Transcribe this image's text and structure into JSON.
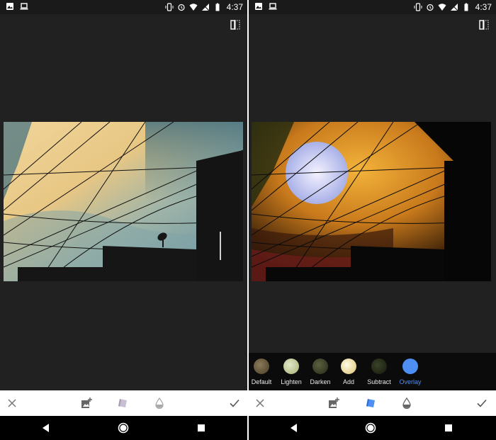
{
  "status": {
    "time": "4:37"
  },
  "blend_modes": [
    {
      "label": "Default",
      "color": "#6b5a3a",
      "active": false
    },
    {
      "label": "Lighten",
      "color": "#b9c29a",
      "active": false
    },
    {
      "label": "Darken",
      "color": "#38402c",
      "active": false
    },
    {
      "label": "Add",
      "color": "#f2eccc",
      "active": false
    },
    {
      "label": "Subtract",
      "color": "#232a18",
      "active": false
    },
    {
      "label": "Overlay",
      "color": "#4e8ff4",
      "active": true
    }
  ],
  "colors": {
    "active_blue": "#4e8ff4",
    "panel_bg": "#212121"
  },
  "icons": {
    "toolbar": [
      "close-icon",
      "add-image-icon",
      "layer-blend-icon",
      "opacity-drop-icon",
      "check-icon"
    ],
    "nav": [
      "back-icon",
      "home-icon",
      "recents-icon"
    ]
  }
}
